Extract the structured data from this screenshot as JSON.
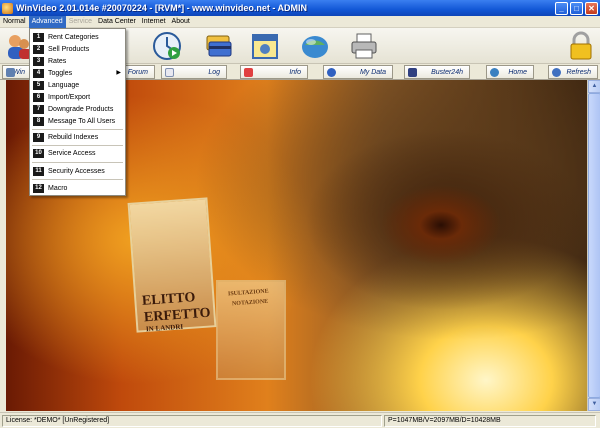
{
  "window": {
    "title": "WinVideo 2.01.014e #20070224 - [RVM*] - www.winvideo.net - ADMIN",
    "minimize": "_",
    "maximize": "□",
    "close": "✕"
  },
  "menubar": {
    "items": [
      {
        "label": "Normal"
      },
      {
        "label": "Advanced"
      },
      {
        "label": "Service"
      },
      {
        "label": "Data Center"
      },
      {
        "label": "Internet"
      },
      {
        "label": "About"
      }
    ]
  },
  "advanced_menu": {
    "items": [
      {
        "num": "1",
        "label": "Rent Categories"
      },
      {
        "num": "2",
        "label": "Sell Products"
      },
      {
        "num": "3",
        "label": "Rates"
      },
      {
        "num": "4",
        "label": "Toggles",
        "submenu_arrow": "▶"
      },
      {
        "num": "5",
        "label": "Language"
      },
      {
        "num": "6",
        "label": "Import/Export"
      },
      {
        "num": "7",
        "label": "Downgrade Products"
      },
      {
        "num": "8",
        "label": "Message To All Users"
      },
      {
        "num": "9",
        "label": "Rebuild Indexes"
      },
      {
        "num": "10",
        "label": "Service Access"
      },
      {
        "num": "11",
        "label": "Security Accesses"
      },
      {
        "num": "12",
        "label": "Macro"
      }
    ]
  },
  "labelbar": {
    "items": [
      {
        "label": "Win"
      },
      {
        "label": "Forum"
      },
      {
        "label": "Log"
      },
      {
        "label": "Info"
      },
      {
        "label": "My Data"
      },
      {
        "label": "Buster24h"
      },
      {
        "label": "Home"
      },
      {
        "label": "Refresh"
      }
    ]
  },
  "background": {
    "poster_text_1": "ELITTO",
    "poster_text_2": "ERFETTO",
    "poster_text_3": "IN LANDRI",
    "poster_text_4": "ISULTAZIONE",
    "poster_text_5": "NOTAZIONE"
  },
  "statusbar": {
    "license": "License: *DEMO* [UnRegistered]",
    "memory": "P=1047MB/V=2097MB/D=10428MB"
  },
  "colors": {
    "title_bar": "#1257d6",
    "menu_highlight": "#316ac5",
    "menu_number_bg": "#1a1a1a"
  }
}
